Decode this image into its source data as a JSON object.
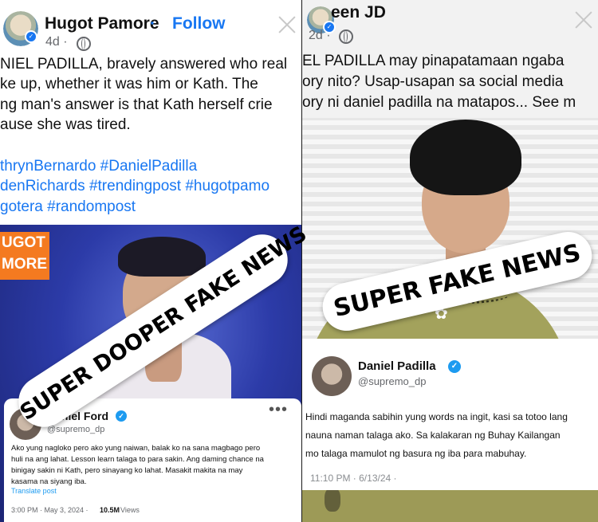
{
  "left_post": {
    "author": "Hugot Pamore",
    "separator": "·",
    "follow_label": "Follow",
    "time": "4d ·",
    "caption_lines": [
      "NIEL PADILLA, bravely answered who real",
      "ke up, whether it was him or Kath. The",
      "ng man's answer is that Kath herself crie",
      "ause she was tired."
    ],
    "hashtag_lines": [
      "thrynBernardo #DanielPadilla",
      "denRichards #trendingpost #hugotpamo",
      "gotera #randompost"
    ],
    "overlay_logo": [
      "UGOT",
      "MORE"
    ],
    "tweet": {
      "name": "Daniel Ford",
      "handle": "@supremo_dp",
      "body_lines": [
        "Ako yung nagloko pero ako yung naiwan, balak ko na sana magbago pero",
        "huli na ang lahat. Lesson learn talaga to para sakin. Ang daming chance na",
        "binigay sakin ni Kath, pero sinayang ko lahat.  Masakit makita na may",
        "kasama na siyang iba."
      ],
      "translate": "Translate post",
      "time": "3:00 PM · May 3, 2024 ·",
      "views_count": "10.5M",
      "views_label": "Views",
      "more": "•••"
    },
    "stamp": "SUPER DOOPER FAKE NEWS"
  },
  "right_post": {
    "author": "een JD",
    "time": "2d ·",
    "caption_lines": [
      "EL PADILLA may pinapatamaan ngaba",
      "ory nito? Usap-usapan sa social media",
      "ory ni daniel padilla na matapos... See m"
    ],
    "tweet": {
      "name": "Daniel Padilla",
      "handle": "@supremo_dp",
      "body_lines": [
        "Hindi maganda sabihin yung words na ingit, kasi sa totoo lang",
        "nauna naman talaga ako. Sa kalakaran ng Buhay Kailangan",
        "mo talaga mamulot ng basura ng iba para mabuhay."
      ],
      "time": "11:10 PM · 6/13/24 ·"
    },
    "stamp": "SUPER FAKE NEWS"
  },
  "icons": [
    "avatar-ring",
    "verified-badge",
    "globe-icon",
    "close-icon",
    "verified-check-icon",
    "more-icon"
  ],
  "colors": {
    "facebook_blue": "#1877f2",
    "twitter_blue": "#1d9bf0",
    "hugot_orange": "#f47a20"
  }
}
